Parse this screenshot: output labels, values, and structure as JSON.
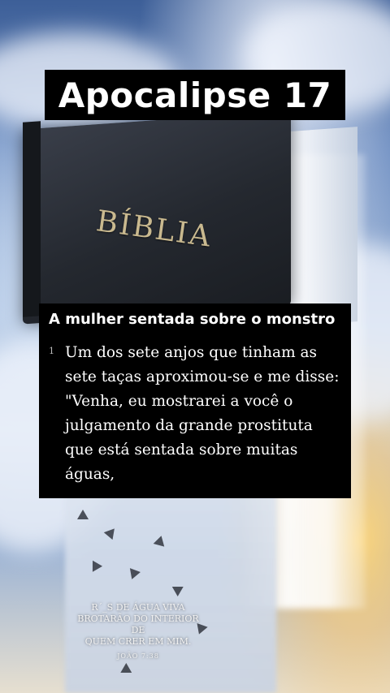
{
  "header": {
    "title": "Apocalipse 17"
  },
  "background": {
    "book_label": "BÍBLIA",
    "caption_lines": [
      "R´_S DE ÁGUA VIVA",
      "BROTARÃO DO INTERIOR DE",
      "QUEM CRER EM MIM."
    ],
    "caption_ref": "JOÃO 7:38",
    "colors": {
      "sky": "#6f8fc2",
      "glow": "#ffd678",
      "book": "#24282f"
    }
  },
  "passage": {
    "subtitle": "A mulher sentada sobre o monstro",
    "verse_number": "1",
    "verse_text": "Um dos sete anjos que tinham as sete taças aproximou-se e me disse: \"Venha, eu mostrarei a você o julgamento da grande prostituta que está sentada sobre muitas águas,"
  },
  "colors": {
    "box_background": "#000000",
    "text": "#ffffff"
  }
}
